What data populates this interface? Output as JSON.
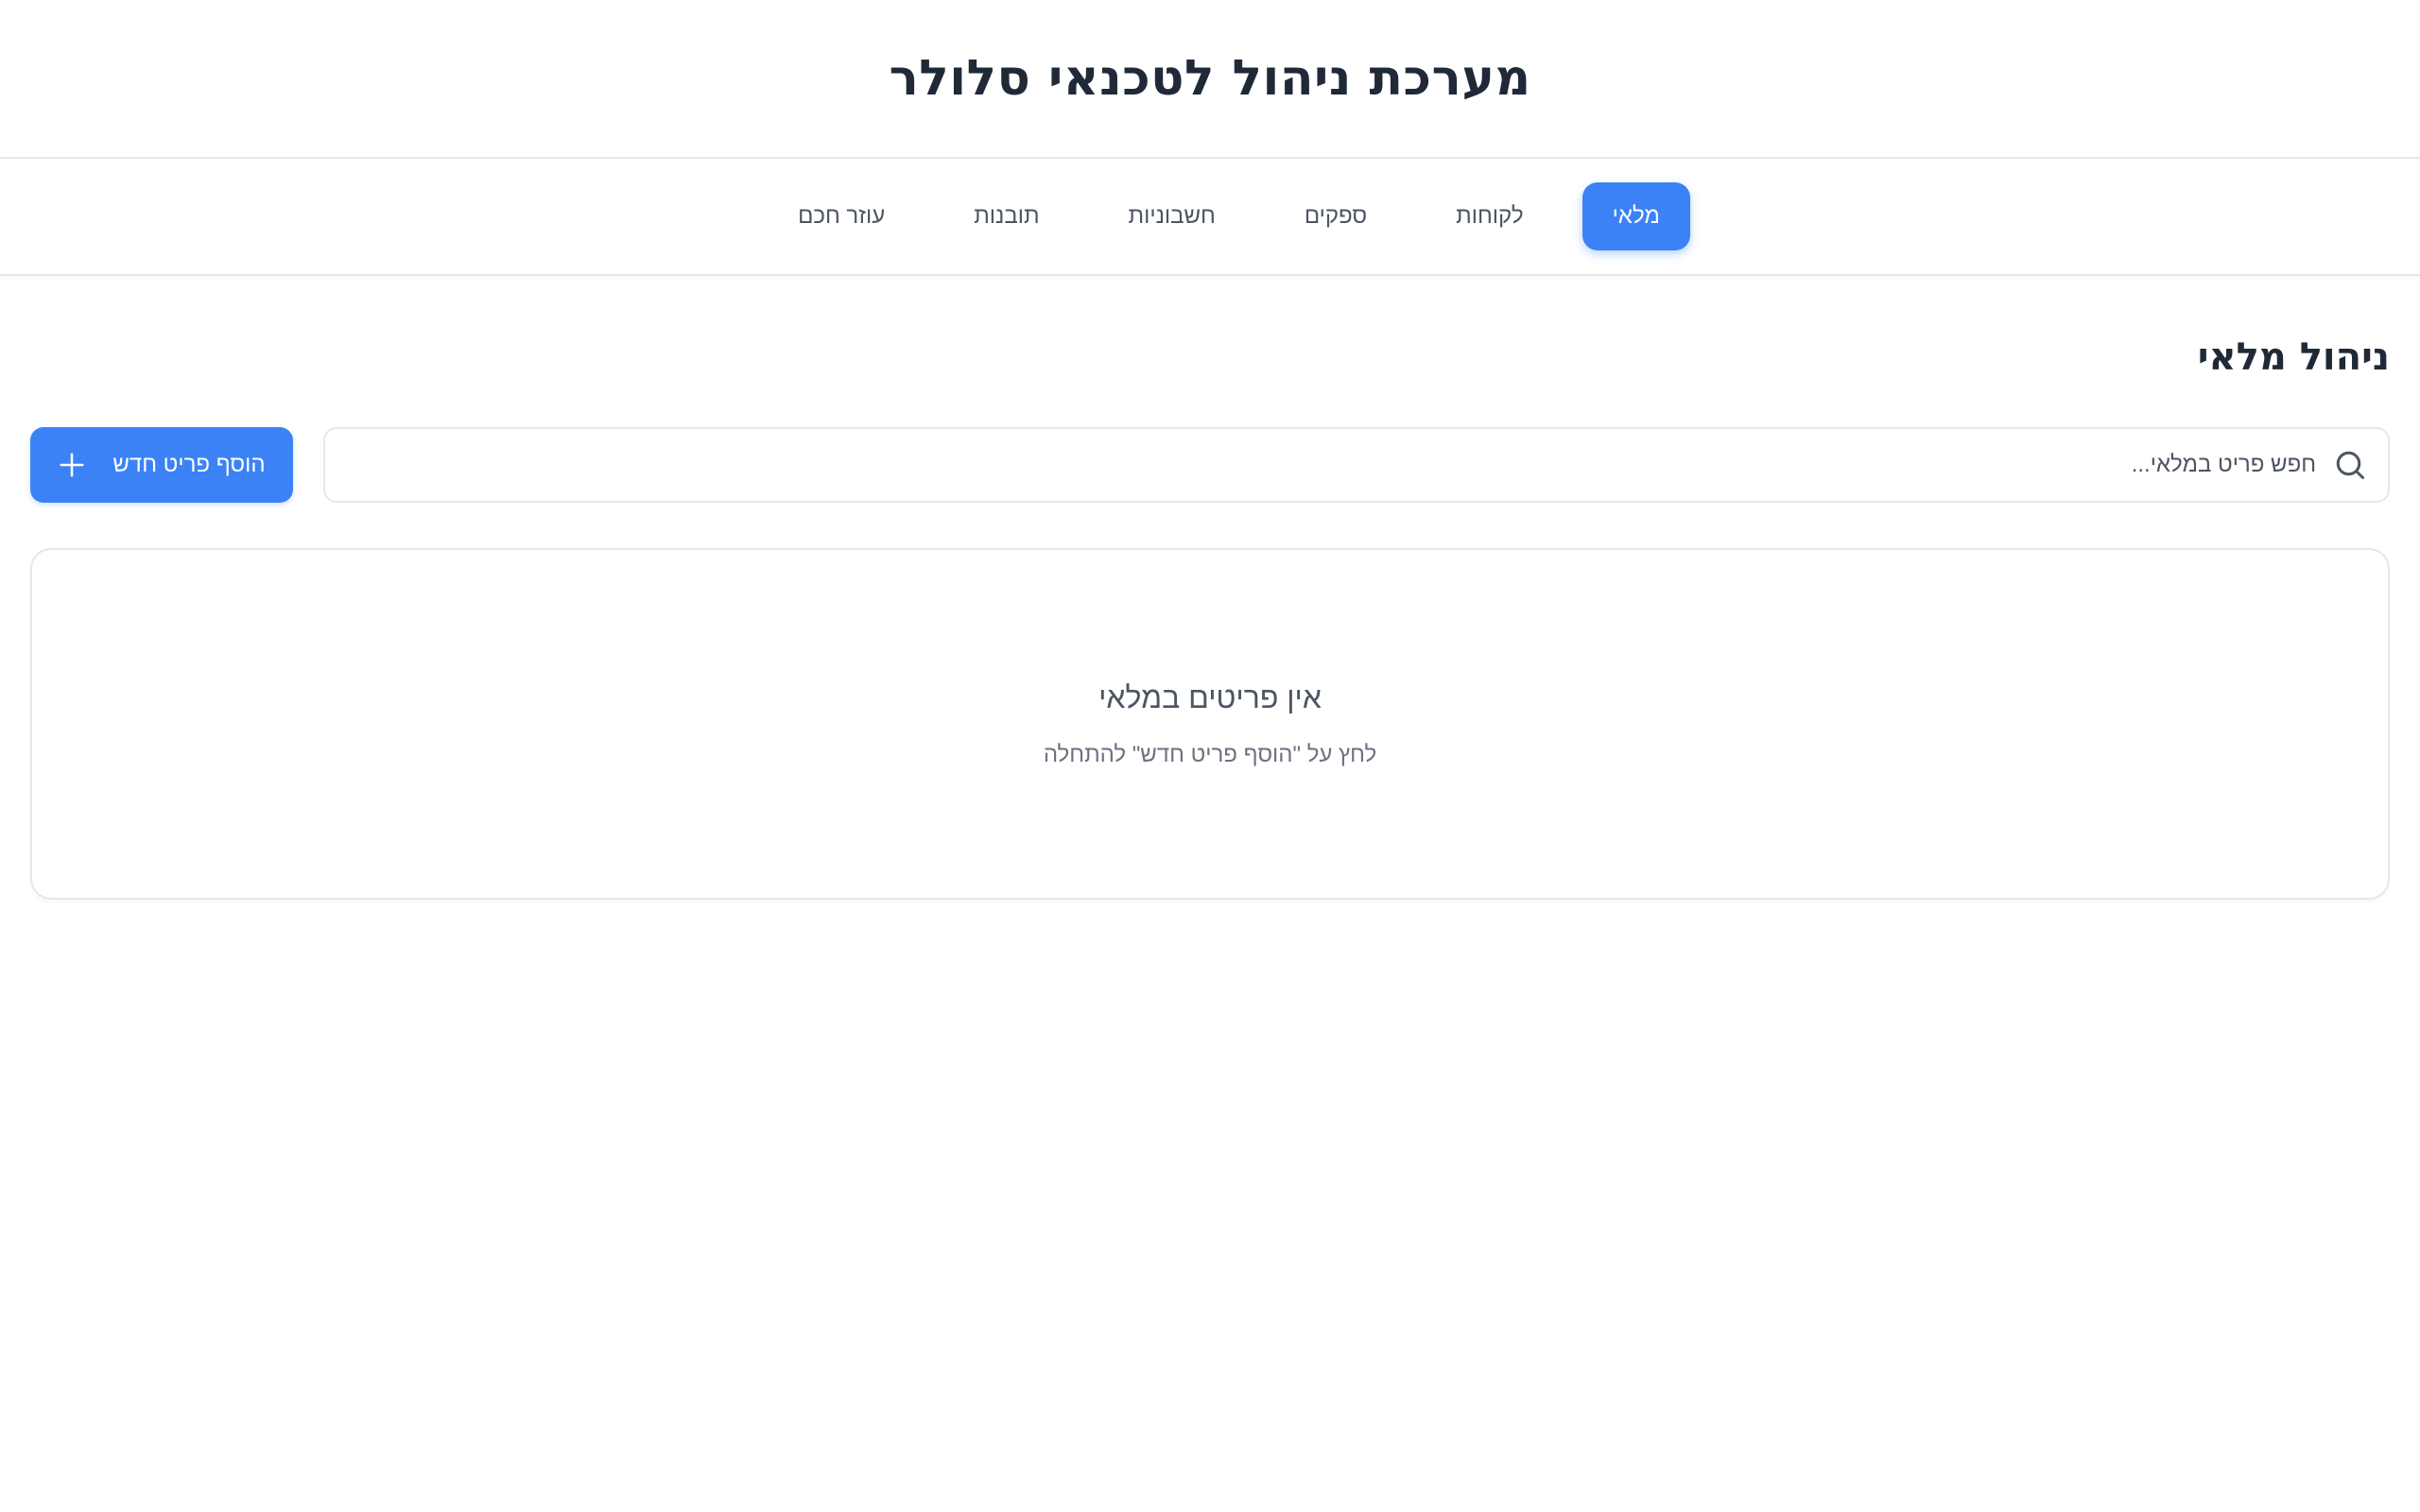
{
  "header": {
    "title": "מערכת ניהול לטכנאי סלולר"
  },
  "nav": {
    "tabs": [
      {
        "label": "מלאי",
        "active": true
      },
      {
        "label": "לקוחות",
        "active": false
      },
      {
        "label": "ספקים",
        "active": false
      },
      {
        "label": "חשבוניות",
        "active": false
      },
      {
        "label": "תובנות",
        "active": false
      },
      {
        "label": "עוזר חכם",
        "active": false
      }
    ]
  },
  "main": {
    "section_title": "ניהול מלאי",
    "search": {
      "placeholder": "חפש פריט במלאי...",
      "value": "",
      "icon": "search-icon"
    },
    "add_button": {
      "label": "הוסף פריט חדש",
      "icon": "plus-icon"
    },
    "empty_state": {
      "title": "אין פריטים במלאי",
      "subtitle": "לחץ על \"הוסף פריט חדש\" להתחלה"
    }
  },
  "colors": {
    "accent": "#3b82f6",
    "text_primary": "#1f2937",
    "text_muted": "#4b5563",
    "border": "#e5e7eb"
  }
}
